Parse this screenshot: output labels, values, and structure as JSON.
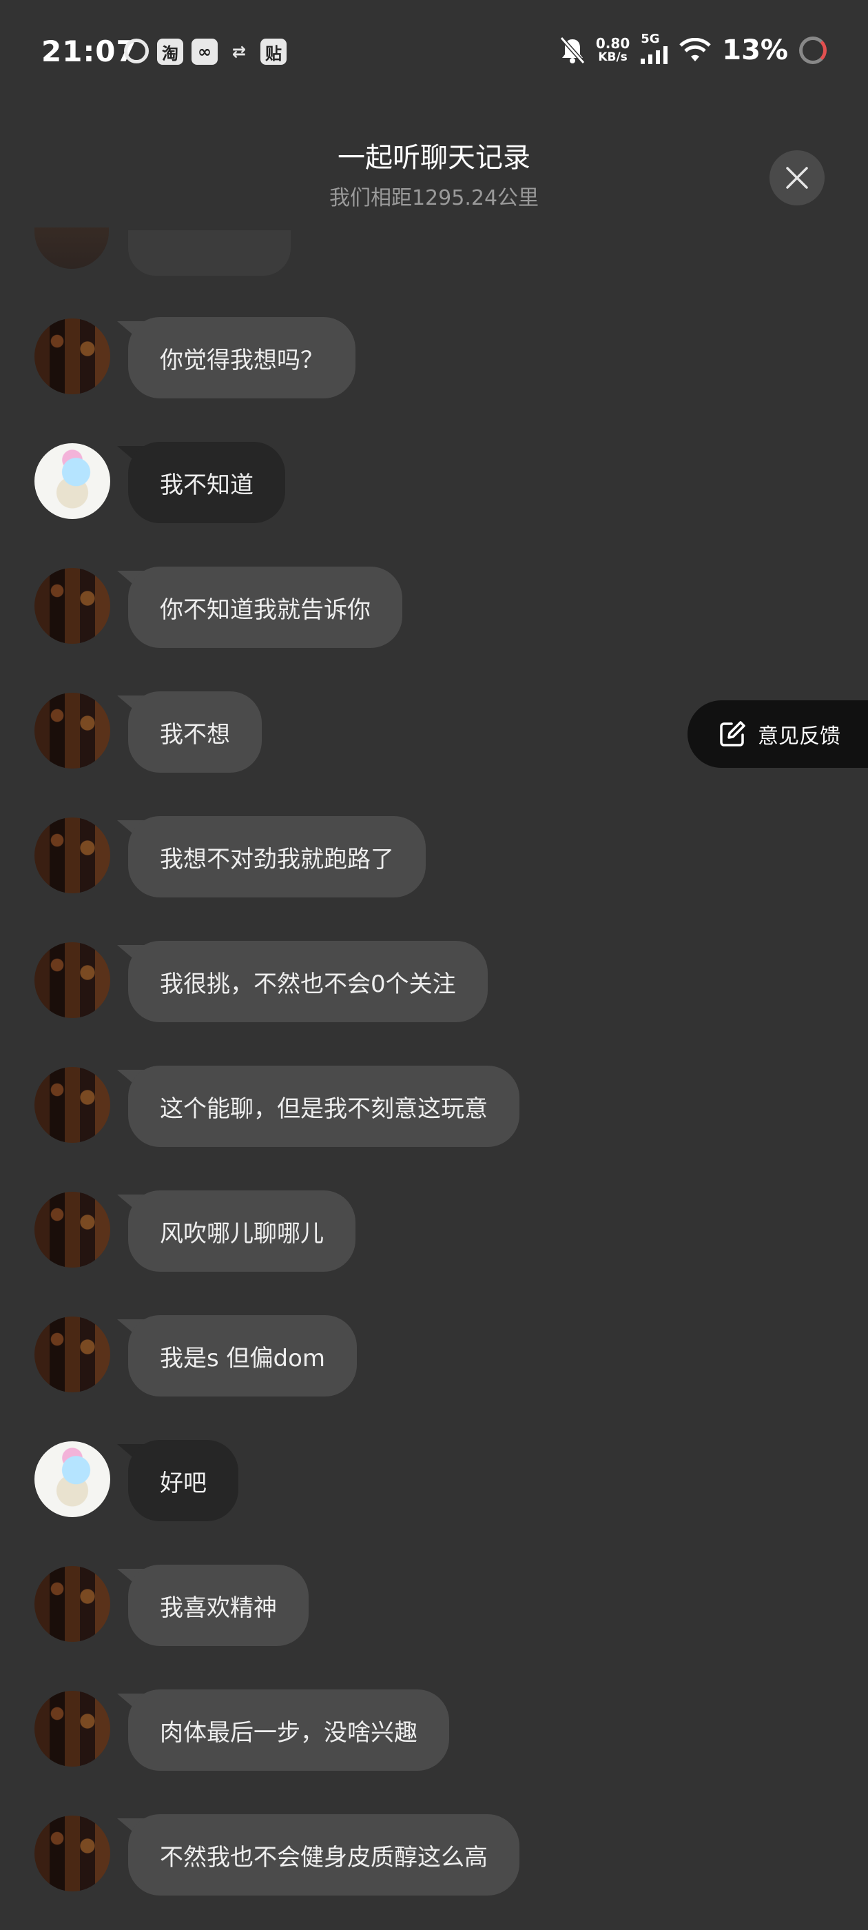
{
  "status_bar": {
    "time": "21:07",
    "app_icons": [
      "sync-ring-icon",
      "taobao-icon",
      "baidu-netdisk-icon",
      "handshake-icon",
      "tieba-icon"
    ],
    "app_icon_labels": {
      "taobao": "淘",
      "tieba": "贴"
    },
    "net_speed": "0.80",
    "net_speed_unit": "KB/s",
    "network": "5G",
    "battery": "13%"
  },
  "header": {
    "title": "一起听聊天记录",
    "subtitle": "我们相距1295.24公里"
  },
  "feedback": {
    "label": "意见反馈"
  },
  "messages": [
    {
      "sender": "other",
      "text": "你觉得我想吗？"
    },
    {
      "sender": "me",
      "text": "我不知道"
    },
    {
      "sender": "other",
      "text": "你不知道我就告诉你"
    },
    {
      "sender": "other",
      "text": "我不想"
    },
    {
      "sender": "other",
      "text": "我想不对劲我就跑路了"
    },
    {
      "sender": "other",
      "text": "我很挑，不然也不会0个关注"
    },
    {
      "sender": "other",
      "text": "这个能聊，但是我不刻意这玩意"
    },
    {
      "sender": "other",
      "text": "风吹哪儿聊哪儿"
    },
    {
      "sender": "other",
      "text": "我是s 但偏dom"
    },
    {
      "sender": "me",
      "text": "好吧"
    },
    {
      "sender": "other",
      "text": "我喜欢精神"
    },
    {
      "sender": "other",
      "text": "肉体最后一步，没啥兴趣"
    },
    {
      "sender": "other",
      "text": "不然我也不会健身皮质醇这么高"
    }
  ],
  "colors": {
    "background": "#333333",
    "bubble_other": "#4b4b4b",
    "bubble_me": "#262626",
    "subtitle": "#9a9a9a",
    "feedback_bg": "#111111"
  }
}
